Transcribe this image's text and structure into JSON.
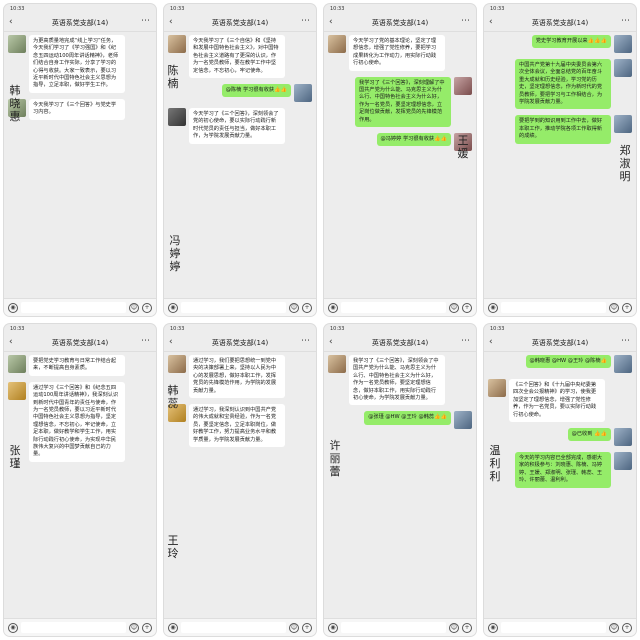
{
  "status_time": "10:33",
  "chat_title": "英语系党支部(14)",
  "panels": [
    {
      "messages": [
        {
          "side": "left",
          "avatar": "a1",
          "color": "white",
          "text": "为更高质量地完成“线上学习”任务，今天我们学习了《学习强国》和《纪念五四运动100周年讲话精神》，老师们结合自身工作实际，分享了学习的心得与收获。大家一致表示，要以习近平新时代中国特色社会主义思想为指导，立足本职，做好学生工作。"
        },
        {
          "side": "left",
          "avatar": "a1",
          "color": "white",
          "text": "今天我学习了《三个回答》与党史学习内容。"
        }
      ],
      "handwriting": "韩晓惠"
    },
    {
      "messages": [
        {
          "side": "left",
          "avatar": "a2",
          "color": "white",
          "text": "今天我学习了《三个自信》和《坚持和发展中国特色社会主义》，对中国特色社会主义道路有了更深的认识，作为一名党员教师，要在教学工作中坚定信念，不忘初心，牢记使命。"
        },
        {
          "side": "right",
          "avatar": "a3",
          "color": "green",
          "text": "@陈楠 学习很有收获👍👍"
        },
        {
          "side": "left",
          "avatar": "a4",
          "color": "white",
          "text": "今天学习了《三个回答》，深刻领会了党的初心使命，要以实际行动践行新时代党员的责任与担当，做好本职工作，为学院发展贡献力量。"
        }
      ],
      "handwriting1": "陈楠",
      "handwriting2": "冯婷婷"
    },
    {
      "messages": [
        {
          "side": "left",
          "avatar": "a2",
          "color": "white",
          "text": "今天学习了党的基本理论，坚定了理想信念，增强了党性修养，要把学习成果转化为工作动力，用实际行动践行初心使命。"
        },
        {
          "side": "right",
          "avatar": "a6",
          "color": "green",
          "text": "我学习了《三个回答》，深刻理解了中国共产党为什么能、马克思主义为什么行、中国特色社会主义为什么好，作为一名党员，要坚定理想信念，立足岗位做贡献，发挥党员的先锋模范作用。"
        },
        {
          "side": "right",
          "avatar": "a6",
          "color": "green",
          "text": "@冯婷婷 学习很有收获👍👍"
        }
      ],
      "handwriting": "王媛"
    },
    {
      "messages": [
        {
          "side": "right",
          "avatar": "a3",
          "color": "green",
          "text": "党史学习教育开展以来👍👍👍"
        },
        {
          "side": "right",
          "avatar": "a3",
          "color": "green",
          "text": "中国共产党第十九届中央委员会第六次全体会议，全面总结党的百年奋斗重大成就和历史经验，学习党的历史，坚定理想信念，作为新时代的党员教师，要把学习与工作相结合，为学院发展贡献力量。"
        },
        {
          "side": "right",
          "avatar": "a3",
          "color": "green",
          "text": "要把学到的知识用到工作中去，做好本职工作，推动学院各项工作取得新的成绩。"
        }
      ],
      "handwriting": "郑淑明"
    },
    {
      "messages": [
        {
          "side": "left",
          "avatar": "a1",
          "color": "white",
          "text": "要把党史学习教育与日常工作结合起来，不断提高自身素质。"
        },
        {
          "side": "left",
          "avatar": "a5",
          "color": "white",
          "text": "通过学习《三个回答》和《纪念五四运动100周年讲话精神》，我深刻认识到新时代中国青年的责任与使命，作为一名党员教师，要以习近平新时代中国特色社会主义思想为指导，坚定理想信念，不忘初心，牢记使命，立足本职，做好教学和学生工作，用实际行动践行初心使命，为实现中华民族伟大复兴的中国梦贡献自己的力量。"
        }
      ],
      "handwriting": "张瑾"
    },
    {
      "messages": [
        {
          "side": "left",
          "avatar": "a2",
          "color": "white",
          "text": "通过学习，我们要把思想统一到党中央的决策部署上来，坚持以人民为中心的发展思想，做好本职工作，发挥党员的先锋模范作用，为学院的发展贡献力量。"
        },
        {
          "side": "left",
          "avatar": "a5",
          "color": "white",
          "text": "通过学习，我深刻认识到中国共产党的伟大成就和宝贵经验，作为一名党员，要坚定信念，立足本职岗位，做好教学工作，努力提高业务水平和教学质量，为学院发展贡献力量。"
        }
      ],
      "handwriting1": "韩蕊",
      "handwriting2": "王玲"
    },
    {
      "messages": [
        {
          "side": "left",
          "avatar": "a2",
          "color": "white",
          "text": "我学习了《三个回答》，深刻领会了中国共产党为什么能、马克思主义为什么行、中国特色社会主义为什么好，作为一名党员教师，要坚定理想信念，做好本职工作，用实际行动践行初心使命，为学院发展贡献力量。"
        },
        {
          "side": "right",
          "avatar": "a3",
          "color": "green",
          "text": "@张瑾 @HW @王玲 @韩蕊👍👍"
        }
      ],
      "handwriting": "许丽蕾"
    },
    {
      "messages": [
        {
          "side": "right",
          "avatar": "a3",
          "color": "green",
          "text": "@韩晓惠 @HW @王玲 @陈楠👍"
        },
        {
          "side": "left",
          "avatar": "a2",
          "color": "white",
          "text": "《三个回答》和《十九届中央纪委第四次全会公报精神》的学习，使我更加坚定了理想信念，增强了党性修养，作为一名党员，要以实际行动践行初心使命。"
        },
        {
          "side": "right",
          "avatar": "a3",
          "color": "green",
          "text": "@已收到 👍👍"
        },
        {
          "side": "right",
          "avatar": "a3",
          "color": "green",
          "text": "今天的学习内容已全部完成，感谢大家的积极参与：刘晓惠、陈楠、冯婷婷、王媛、郑淑明、张瑾、韩蕊、王玲、许丽蕾、温利利。"
        }
      ],
      "handwriting": "温利利"
    }
  ]
}
